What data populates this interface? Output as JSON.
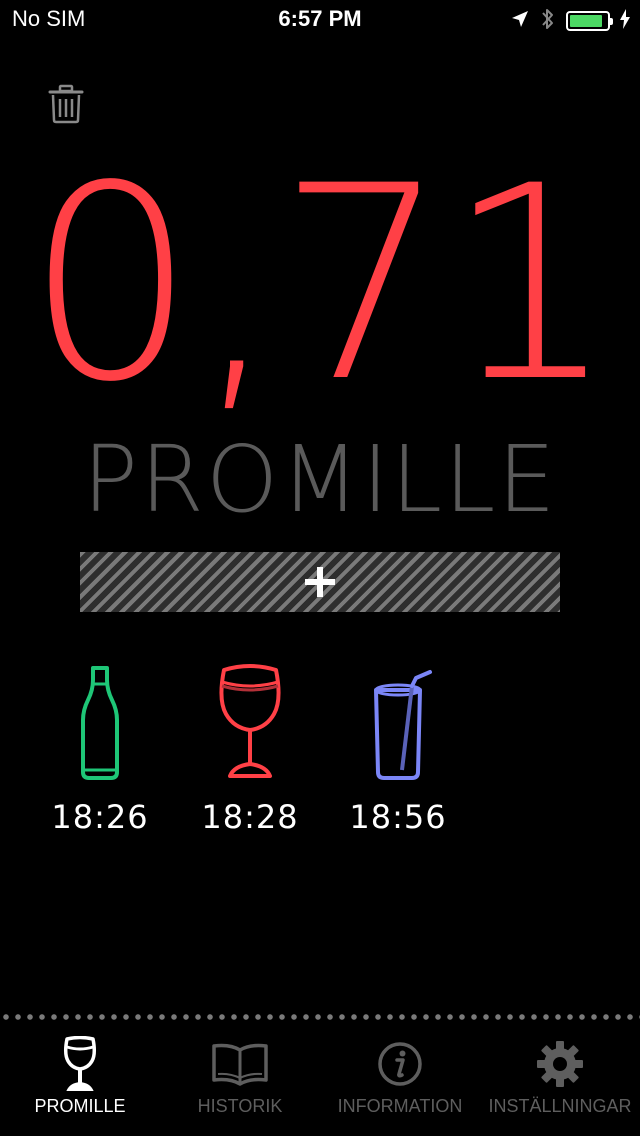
{
  "status_bar": {
    "carrier": "No SIM",
    "time": "6:57 PM",
    "icons": [
      "location-arrow-icon",
      "bluetooth-icon",
      "battery-charging-icon"
    ],
    "battery_color": "#4cd964"
  },
  "main": {
    "trash_icon": "trash-icon",
    "bac_value": "0,71",
    "bac_color": "#ff4046",
    "unit_label": "PROMILLE",
    "add_icon": "plus-icon",
    "drinks": [
      {
        "icon": "beer-bottle-icon",
        "color": "#1ec677",
        "time": "18:26"
      },
      {
        "icon": "wine-glass-icon",
        "color": "#ff4046",
        "time": "18:28"
      },
      {
        "icon": "drink-glass-straw-icon",
        "color": "#7b86f7",
        "time": "18:56"
      }
    ]
  },
  "tab_bar": {
    "tabs": [
      {
        "label": "PROMILLE",
        "icon": "wine-glass-icon",
        "active": true
      },
      {
        "label": "HISTORIK",
        "icon": "book-icon",
        "active": false
      },
      {
        "label": "INFORMATION",
        "icon": "info-icon",
        "active": false
      },
      {
        "label": "INSTÄLLNINGAR",
        "icon": "gear-icon",
        "active": false
      }
    ]
  }
}
